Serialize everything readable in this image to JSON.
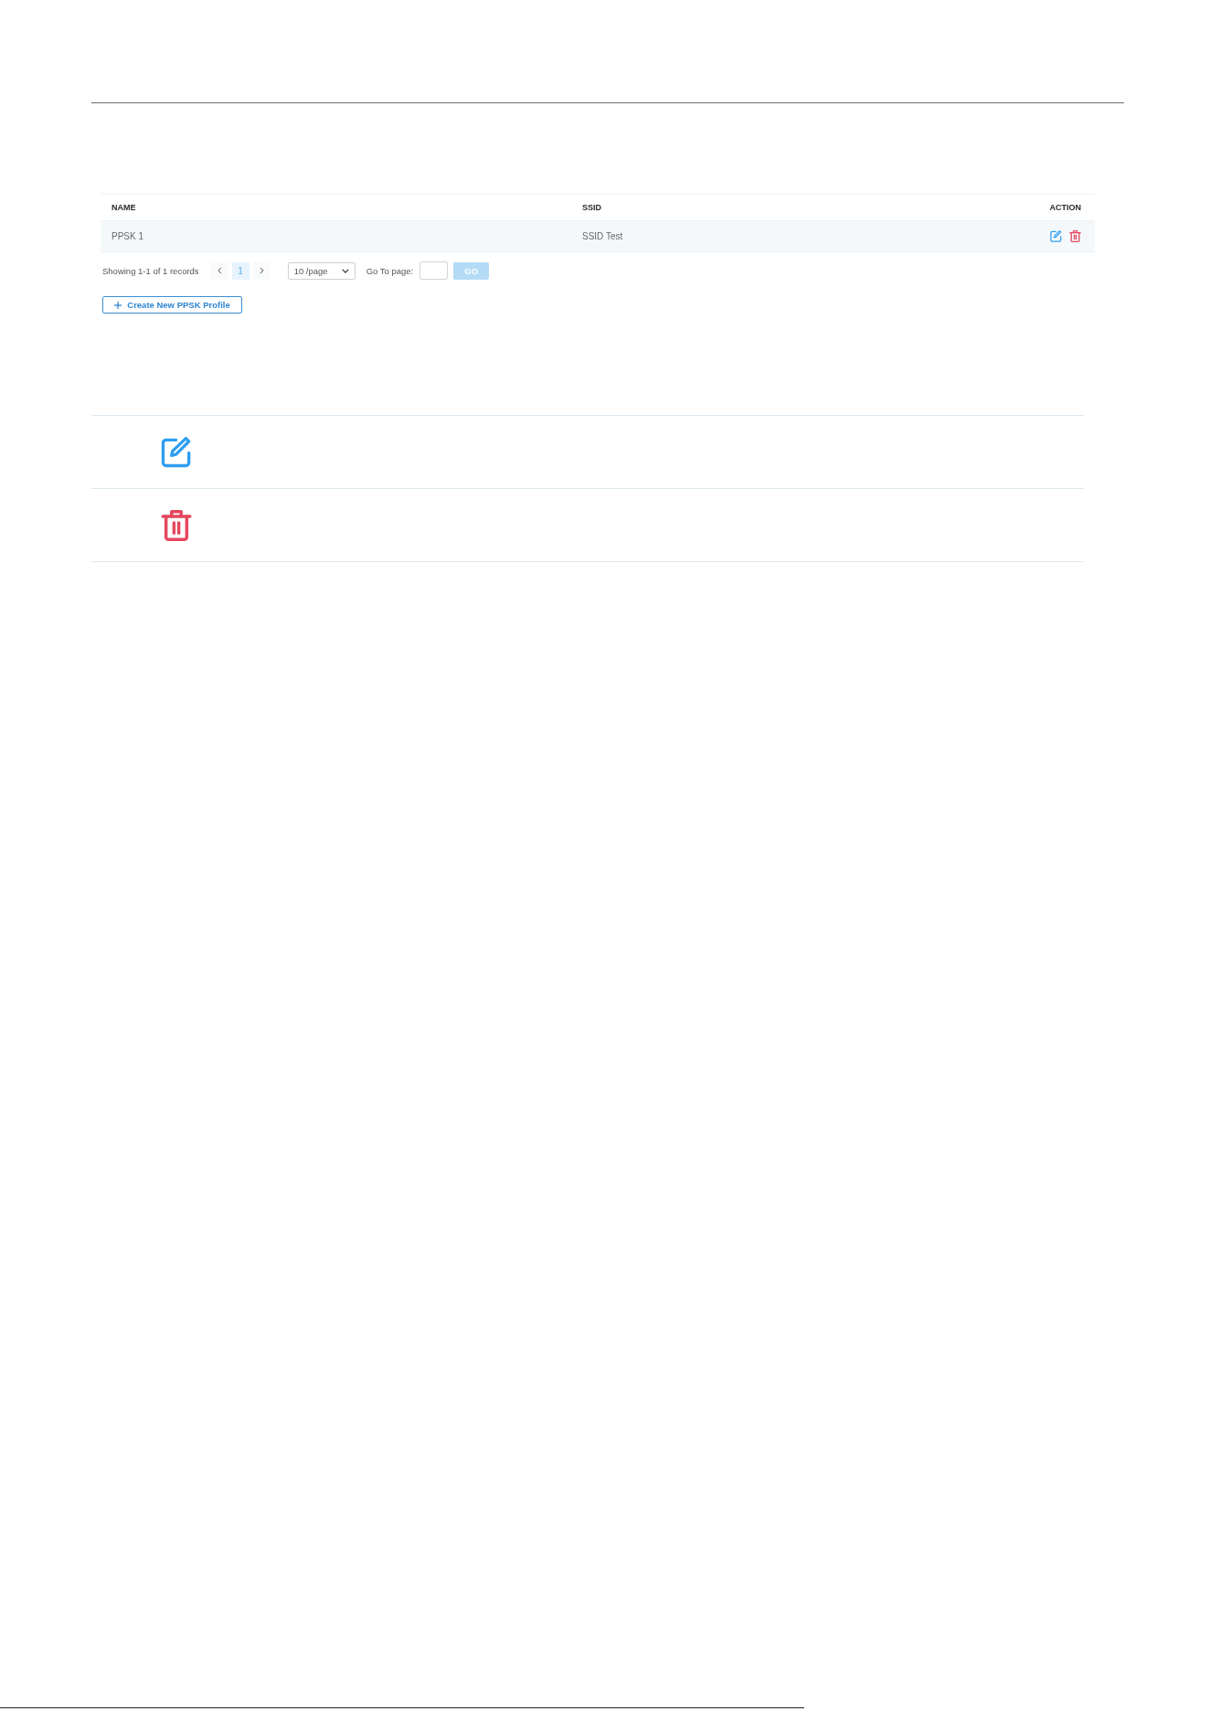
{
  "table": {
    "columns": [
      "NAME",
      "SSID",
      "ACTION"
    ],
    "rows": [
      {
        "name": "PPSK 1",
        "ssid": "SSID Test",
        "actions": [
          {
            "kind": "edit"
          },
          {
            "kind": "delete"
          }
        ]
      }
    ]
  },
  "pagination": {
    "summary": "Showing 1-1 of 1 records",
    "pages": [
      {
        "label": "1",
        "selected": true
      }
    ],
    "page_size": "10 /page",
    "goto_label": "Go To page:",
    "go_button": {
      "label": "GO",
      "disabled": true
    }
  },
  "create_button": {
    "label": "Create New PPSK Profile"
  },
  "icon_legend": [
    {
      "kind": "edit"
    },
    {
      "kind": "delete"
    }
  ]
}
